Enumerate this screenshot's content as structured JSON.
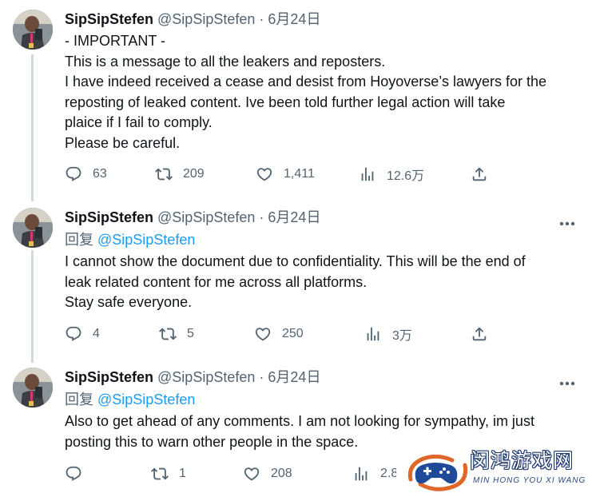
{
  "tweets": [
    {
      "display_name": "SipSipStefen",
      "handle": "@SipSipStefen",
      "separator": "·",
      "date": "6月24日",
      "reply_to": null,
      "lines": [
        "- IMPORTANT -",
        "This is a message to all the leakers and reposters.",
        "I have indeed received a cease and desist from Hoyoverse’s lawyers for the",
        "reposting of leaked content. Ive been told further legal action will take",
        "plaice if I fail to comply.",
        "Please be careful."
      ],
      "replies": "63",
      "reposts": "209",
      "likes": "1,411",
      "views": "12.6万"
    },
    {
      "display_name": "SipSipStefen",
      "handle": "@SipSipStefen",
      "separator": "·",
      "date": "6月24日",
      "reply_prefix": "回复",
      "reply_to": "@SipSipStefen",
      "lines": [
        "I cannot show the document due to confidentiality. This will be the end of",
        "leak related content for me across all platforms.",
        "Stay safe everyone."
      ],
      "replies": "4",
      "reposts": "5",
      "likes": "250",
      "views": "3万"
    },
    {
      "display_name": "SipSipStefen",
      "handle": "@SipSipStefen",
      "separator": "·",
      "date": "6月24日",
      "reply_prefix": "回复",
      "reply_to": "@SipSipStefen",
      "lines": [
        "Also to get ahead of any comments. I am not looking for sympathy, im just",
        "posting this to warn other people in the space."
      ],
      "replies": "",
      "reposts": "1",
      "likes": "208",
      "views": "2.8"
    }
  ],
  "icons": {
    "reply": "reply-icon",
    "repost": "repost-icon",
    "like": "heart-icon",
    "views": "views-icon",
    "share": "share-icon",
    "more": "more-icon"
  },
  "watermark": {
    "title": "闵鸿游戏网",
    "subtitle": "MIN HONG YOU XI WANG"
  },
  "colors": {
    "link": "#1d9bf0",
    "secondary_text": "#536471",
    "primary_text": "#0f1419",
    "thread_line": "#cfd9de"
  }
}
